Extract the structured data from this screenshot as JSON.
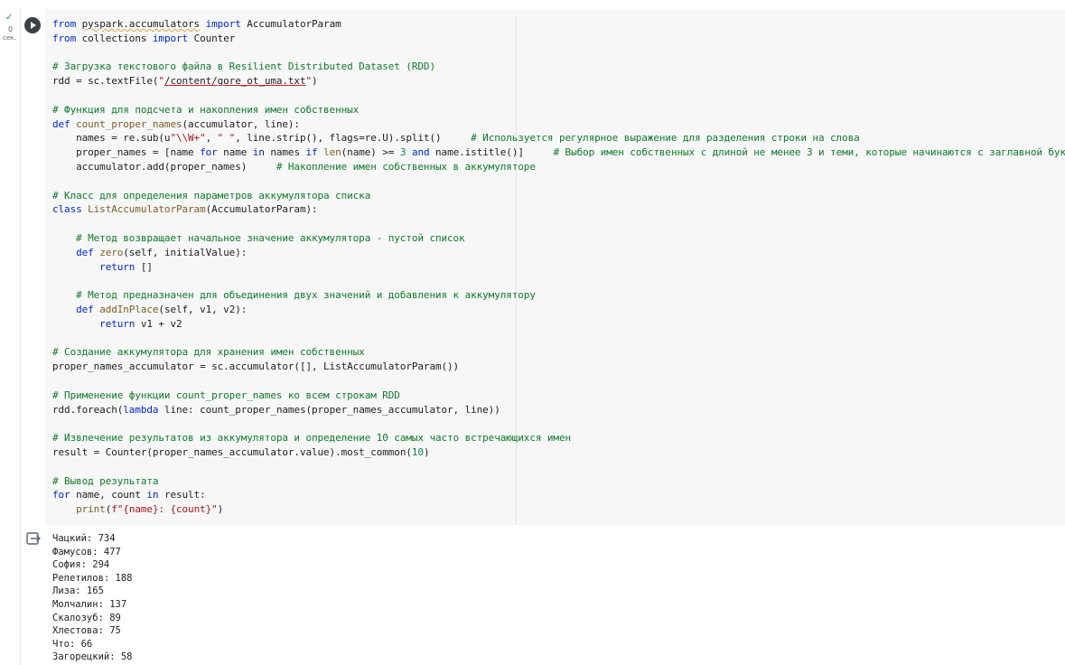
{
  "cell": {
    "status": {
      "check": "✓",
      "duration": "0",
      "unit": "сек."
    },
    "run_button": "run-cell",
    "code_lines": [
      [
        [
          "kw",
          "from "
        ],
        [
          "sq",
          "pyspark.accumulators"
        ],
        [
          "kw",
          " import "
        ],
        [
          "",
          "AccumulatorParam"
        ]
      ],
      [
        [
          "kw",
          "from "
        ],
        [
          "",
          "collections "
        ],
        [
          "kw",
          "import "
        ],
        [
          "",
          "Counter"
        ]
      ],
      [],
      [
        [
          "cm",
          "# Загрузка текстового файла в Resilient Distributed Dataset (RDD)"
        ]
      ],
      [
        [
          "",
          "rdd = sc.textFile("
        ],
        [
          "st",
          "\""
        ],
        [
          "ul",
          "/content/gore_ot_uma.txt"
        ],
        [
          "st",
          "\""
        ],
        [
          "",
          ")"
        ]
      ],
      [],
      [
        [
          "cm",
          "# Функция для подсчета и накопления имен собственных"
        ]
      ],
      [
        [
          "kw",
          "def "
        ],
        [
          "fn",
          "count_proper_names"
        ],
        [
          "",
          "(accumulator, line):"
        ]
      ],
      [
        [
          "",
          "    names = re.sub(u"
        ],
        [
          "st",
          "\"\\\\W+\""
        ],
        [
          "",
          ", "
        ],
        [
          "st",
          "\" \""
        ],
        [
          "",
          ", line.strip(), flags=re.U).split()     "
        ],
        [
          "cm",
          "# Используется регулярное выражение для разделения строки на слова"
        ]
      ],
      [
        [
          "",
          "    proper_names = [name "
        ],
        [
          "kw",
          "for"
        ],
        [
          "",
          " name "
        ],
        [
          "kw",
          "in"
        ],
        [
          "",
          " names "
        ],
        [
          "kw",
          "if"
        ],
        [
          "",
          ""
        ],
        [
          "fn",
          " len"
        ],
        [
          "",
          "(name) >= "
        ],
        [
          "nm",
          "3"
        ],
        [
          "kw",
          " and"
        ],
        [
          "",
          ""
        ],
        [
          "",
          ""
        ],
        [
          "",
          ""
        ],
        [
          "",
          ""
        ],
        [
          "",
          ""
        ],
        [
          "",
          ""
        ],
        [
          "",
          ""
        ],
        [
          "",
          ""
        ],
        [
          "",
          ""
        ],
        [
          "",
          ""
        ],
        [
          "",
          ""
        ],
        [
          "",
          ""
        ],
        [
          "",
          ""
        ],
        [
          "",
          ""
        ],
        [
          "",
          ""
        ],
        [
          "",
          ""
        ],
        [
          "",
          ""
        ],
        [
          "",
          ""
        ],
        [
          "",
          ""
        ],
        [
          "",
          ""
        ],
        [
          "",
          ""
        ],
        [
          "",
          ""
        ],
        [
          "",
          ""
        ],
        [
          "",
          ""
        ],
        [
          "",
          ""
        ],
        [
          "",
          ""
        ],
        [
          "",
          ""
        ],
        [
          "",
          ""
        ],
        [
          "",
          ""
        ],
        [
          "",
          ""
        ],
        [
          "",
          ""
        ],
        [
          "",
          ""
        ],
        [
          "",
          ""
        ],
        [
          "",
          ""
        ],
        [
          "",
          ""
        ],
        [
          "",
          ""
        ],
        [
          "",
          ""
        ],
        [
          "",
          ""
        ],
        [
          "",
          ""
        ],
        [
          "",
          ""
        ],
        [
          "",
          ""
        ],
        [
          "",
          ""
        ],
        [
          "",
          ""
        ],
        [
          "",
          ""
        ],
        [
          "",
          ""
        ],
        [
          "",
          ""
        ],
        [
          "",
          ""
        ],
        [
          "",
          ""
        ],
        [
          "",
          ""
        ],
        [
          "",
          ""
        ],
        [
          "",
          ""
        ],
        [
          "",
          ""
        ],
        [
          "",
          ""
        ],
        [
          "",
          ""
        ],
        [
          "",
          ""
        ],
        [
          "",
          ""
        ],
        [
          "",
          ""
        ],
        [
          "",
          ""
        ],
        [
          "",
          ""
        ],
        [
          "",
          ""
        ],
        [
          "",
          ""
        ],
        [
          "",
          ""
        ],
        [
          "",
          ""
        ],
        [
          "",
          ""
        ],
        [
          "",
          " name.istitle()]     "
        ],
        [
          "cm",
          "# Выбор имен собственных с длиной не менее 3 и теми, которые начинаются с заглавной буквы"
        ]
      ],
      [
        [
          "",
          "    accumulator.add(proper_names)     "
        ],
        [
          "cm",
          "# Накопление имен собственных в аккумуляторе"
        ]
      ],
      [],
      [
        [
          "cm",
          "# Класс для определения параметров аккумулятора списка"
        ]
      ],
      [
        [
          "kw",
          "class "
        ],
        [
          "fn",
          "ListAccumulatorParam"
        ],
        [
          "",
          "(AccumulatorParam):"
        ]
      ],
      [],
      [
        [
          "cm",
          "    # Метод возвращает начальное значение аккумулятора - пустой список"
        ]
      ],
      [
        [
          "kw",
          "    def "
        ],
        [
          "fn",
          "zero"
        ],
        [
          "",
          "(self, initialValue):"
        ]
      ],
      [
        [
          "kw",
          "        return "
        ],
        [
          "",
          "[]"
        ]
      ],
      [],
      [
        [
          "cm",
          "    # Метод предназначен для объединения двух значений и добавления к аккумулятору"
        ]
      ],
      [
        [
          "kw",
          "    def "
        ],
        [
          "fn",
          "addInPlace"
        ],
        [
          "",
          "(self, v1, v2):"
        ]
      ],
      [
        [
          "kw",
          "        return "
        ],
        [
          "",
          "v1 + v2"
        ]
      ],
      [],
      [
        [
          "cm",
          "# Создание аккумулятора для хранения имен собственных"
        ]
      ],
      [
        [
          "",
          "proper_names_accumulator = sc.accumulator([], ListAccumulatorParam())"
        ]
      ],
      [],
      [
        [
          "cm",
          "# Применение функции count_proper_names ко всем строкам RDD"
        ]
      ],
      [
        [
          "",
          "rdd.foreach("
        ],
        [
          "kw",
          "lambda"
        ],
        [
          "",
          " line: count_proper_names(proper_names_accumulator, line))"
        ]
      ],
      [],
      [
        [
          "cm",
          "# Извлечение результатов из аккумулятора и определение 10 самых часто встречающихся имен"
        ]
      ],
      [
        [
          "",
          "result = Counter(proper_names_accumulator.value).most_common("
        ],
        [
          "nm",
          "10"
        ],
        [
          "",
          ")"
        ]
      ],
      [],
      [
        [
          "cm",
          "# Вывод результата"
        ]
      ],
      [
        [
          "kw",
          "for "
        ],
        [
          "",
          "name, count "
        ],
        [
          "kw",
          "in "
        ],
        [
          "",
          "result:"
        ]
      ],
      [
        [
          "",
          "    "
        ],
        [
          "fn",
          "print"
        ],
        [
          "",
          "("
        ],
        [
          "st",
          "f\"{name}: {count}\""
        ],
        [
          "",
          ")"
        ]
      ]
    ]
  },
  "output": {
    "lines": [
      "Чацкий: 734",
      "Фамусов: 477",
      "София: 294",
      "Репетилов: 188",
      "Лиза: 165",
      "Молчалин: 137",
      "Скалозуб: 89",
      "Хлестова: 75",
      "Что: 66",
      "Загорецкий: 58"
    ]
  }
}
